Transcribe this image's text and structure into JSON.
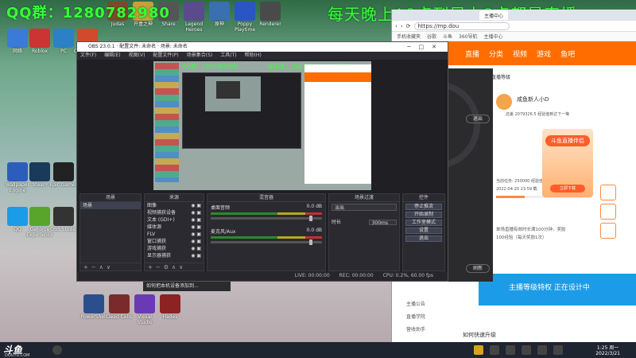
{
  "overlay": {
    "left_text": "QQ群：1280782980",
    "right_text": "每天晚上10点到早上8点都是直播"
  },
  "desktop_icons": [
    {
      "label": "网络",
      "color": "#3b7ad8"
    },
    {
      "label": "Roblox",
      "color": "#cc3333"
    },
    {
      "label": "PC",
      "color": "#2c80c6"
    },
    {
      "label": "Office 2010",
      "color": "#d04a2c"
    },
    {
      "label": "Judas",
      "color": "#7a4a2a"
    },
    {
      "label": "开盒之神",
      "color": "#c4a13b"
    },
    {
      "label": "Share",
      "color": "#555"
    },
    {
      "label": "Legend Heroes",
      "color": "#5a4b8c"
    },
    {
      "label": "原神",
      "color": "#3a6fb0"
    },
    {
      "label": "Poppy Playtime",
      "color": "#2a55c6"
    },
    {
      "label": "Renderer",
      "color": "#4a4a4a"
    },
    {
      "label": "回收站",
      "color": "#9ab4c8"
    },
    {
      "label": "Wallpaper Engine",
      "color": "#2c5dbd"
    },
    {
      "label": "Steam",
      "color": "#1a3a5a"
    },
    {
      "label": "Epic Games",
      "color": "#222"
    },
    {
      "label": "微信",
      "color": "#2fb52f"
    },
    {
      "label": "QQ",
      "color": "#1a9ce8"
    },
    {
      "label": "GeForce Experience",
      "color": "#59a52c"
    },
    {
      "label": "OBS Studio",
      "color": "#333"
    },
    {
      "label": "控制面板",
      "color": "#4b84c4"
    },
    {
      "label": "PowerShell",
      "color": "#2b4f8c"
    },
    {
      "label": "Dead Cells",
      "color": "#7a2a2a"
    },
    {
      "label": "Visual Studio",
      "color": "#6a3ab4"
    },
    {
      "label": "Hades",
      "color": "#8c2222"
    }
  ],
  "browser": {
    "tab": "主播中心",
    "url": "https://mp.dou",
    "bookmarks": [
      "手机收藏夹",
      "谷歌",
      "斗鱼",
      "360导航",
      "主播中心"
    ],
    "nav": [
      "直播",
      "分类",
      "视频",
      "游戏",
      "鱼吧"
    ],
    "left_menu": [
      "主播公告",
      "直播学院",
      "营收助手"
    ],
    "content": {
      "header": "直播等级",
      "name": "咸鱼新人小D",
      "exp": "还差 2079326.5 经验值到达下一等",
      "task": "当前任务: 250000 经验值 / 累计任务经验 75000",
      "date": "2022-04-20 23:59 截",
      "tip1": "单场直播有效时长满100分钟，奖励",
      "tip2": "100经验（每天奖励1次）",
      "bottom": "如何快速升级"
    },
    "promo": {
      "title": "斗鱼直播伴侣",
      "button": "立即下载"
    },
    "vip": "主播等级特权 正在设计中"
  },
  "obs": {
    "title": "OBS 23.0.1 · 配置文件: 未命名 · 场景: 未命名",
    "menu": [
      "文件(F)",
      "编辑(E)",
      "视图(V)",
      "配置文件(P)",
      "场景集合(S)",
      "工具(T)",
      "帮助(H)"
    ],
    "docks": {
      "scenes_title": "场景",
      "sources_title": "来源",
      "mixer_title": "混音器",
      "transition_title": "场景过渡",
      "controls_title": "控件"
    },
    "scenes": [
      "场景"
    ],
    "sources": [
      "图像",
      "视频捕获设备",
      "文本 (GDI+)",
      "媒体源",
      "FLV",
      "窗口捕获",
      "游戏捕获",
      "显示器捕获"
    ],
    "mixer": [
      {
        "name": "桌面音频",
        "db": "0.0 dB"
      },
      {
        "name": "麦克风/Aux",
        "db": "0.0 dB"
      }
    ],
    "transition": {
      "value": "淡出",
      "duration_label": "时长",
      "duration": "300ms"
    },
    "controls": [
      "停止推流",
      "开始录制",
      "工作室模式",
      "设置",
      "退出"
    ],
    "status": {
      "live": "LIVE: 00:00:00",
      "rec": "REC: 00:00:00",
      "cpu": "CPU: 0.2%, 60.00 fps"
    }
  },
  "dark_app": {
    "button1": "退出",
    "button2": "刷新"
  },
  "notification": "如何把本机设备添加到...",
  "taskbar": {
    "logo": "斗鱼",
    "logo_sub": "DOUYU.COM",
    "time": "1:25 周一",
    "date": "2022/3/21"
  }
}
